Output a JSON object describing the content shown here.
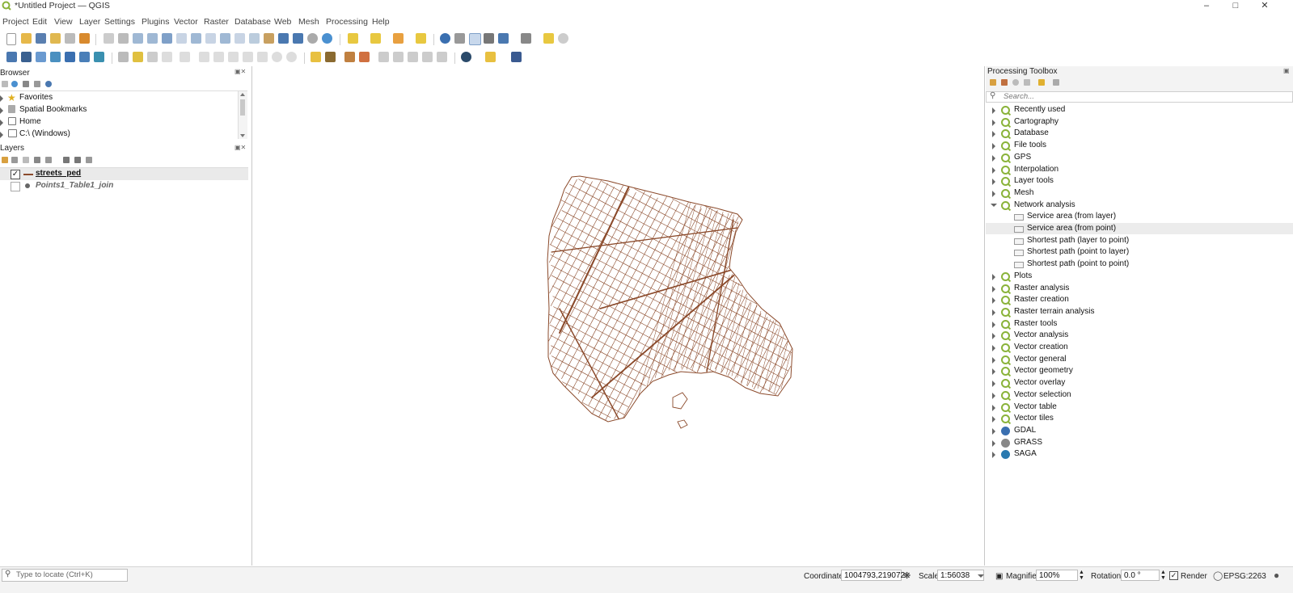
{
  "window": {
    "title": "*Untitled Project — QGIS"
  },
  "menu": [
    "Project",
    "Edit",
    "View",
    "Layer",
    "Settings",
    "Plugins",
    "Vector",
    "Raster",
    "Database",
    "Web",
    "Mesh",
    "Processing",
    "Help"
  ],
  "browser": {
    "title": "Browser",
    "items": [
      "Favorites",
      "Spatial Bookmarks",
      "Home",
      "C:\\ (Windows)"
    ]
  },
  "layers": {
    "title": "Layers",
    "items": [
      {
        "name": "streets_ped",
        "checked": true
      },
      {
        "name": "Points1_Table1_join",
        "checked": false
      }
    ]
  },
  "toolbox": {
    "title": "Processing Toolbox",
    "search_placeholder": "Search...",
    "groups": [
      "Recently used",
      "Cartography",
      "Database",
      "File tools",
      "GPS",
      "Interpolation",
      "Layer tools",
      "Mesh",
      "Network analysis"
    ],
    "network_children": [
      "Service area (from layer)",
      "Service area (from point)",
      "Shortest path (layer to point)",
      "Shortest path (point to layer)",
      "Shortest path (point to point)"
    ],
    "groups_after": [
      "Plots",
      "Raster analysis",
      "Raster creation",
      "Raster terrain analysis",
      "Raster tools",
      "Vector analysis",
      "Vector creation",
      "Vector general",
      "Vector geometry",
      "Vector overlay",
      "Vector selection",
      "Vector table",
      "Vector tiles"
    ],
    "providers": [
      "GDAL",
      "GRASS",
      "SAGA"
    ]
  },
  "status": {
    "locate_placeholder": "Type to locate (Ctrl+K)",
    "coordinate_label": "Coordinate",
    "coordinate_value": "1004793,219072",
    "scale_label": "Scale",
    "scale_value": "1:56038",
    "magnifier_label": "Magnifier",
    "magnifier_value": "100%",
    "rotation_label": "Rotation",
    "rotation_value": "0.0 °",
    "render_label": "Render",
    "crs_value": "EPSG:2263"
  },
  "colors": {
    "street_line": "#8b4a2b",
    "qgis_green": "#8ab33a"
  }
}
